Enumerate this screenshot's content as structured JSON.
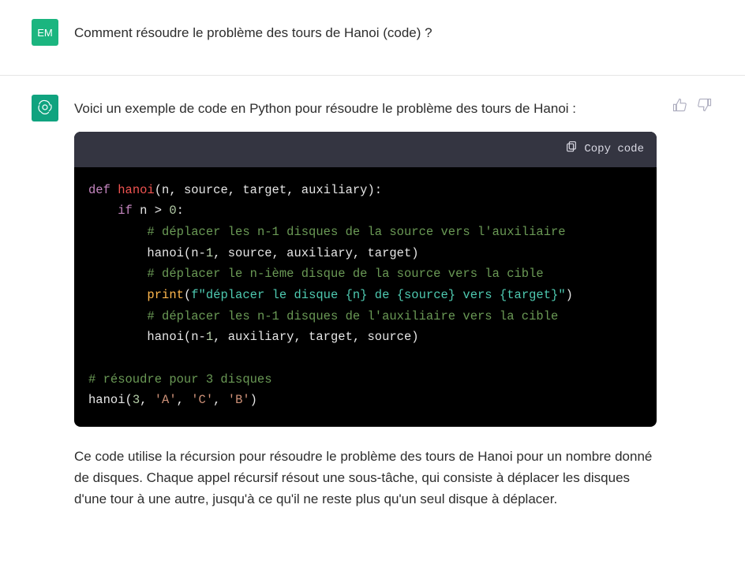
{
  "user": {
    "avatar_initials": "EM",
    "question": "Comment résoudre le problème des tours de Hanoi (code) ?"
  },
  "assistant": {
    "intro": "Voici un exemple de code en Python pour résoudre le problème des tours de Hanoi :",
    "copy_label": "Copy code",
    "explanation": "Ce code utilise la récursion pour résoudre le problème des tours de Hanoi pour un nombre donné de disques. Chaque appel récursif résout une sous-tâche, qui consiste à déplacer les disques d'une tour à une autre, jusqu'à ce qu'il ne reste plus qu'un seul disque à déplacer.",
    "code_tokens": [
      [
        [
          "kw",
          "def "
        ],
        [
          "fn",
          "hanoi"
        ],
        [
          "plain",
          "(n, source, target, auxiliary):"
        ]
      ],
      [
        [
          "plain",
          "    "
        ],
        [
          "kw",
          "if"
        ],
        [
          "plain",
          " n > "
        ],
        [
          "num",
          "0"
        ],
        [
          "plain",
          ":"
        ]
      ],
      [
        [
          "plain",
          "        "
        ],
        [
          "cmt",
          "# déplacer les n-1 disques de la source vers l'auxiliaire"
        ]
      ],
      [
        [
          "plain",
          "        hanoi(n-"
        ],
        [
          "num",
          "1"
        ],
        [
          "plain",
          ", source, auxiliary, target)"
        ]
      ],
      [
        [
          "plain",
          "        "
        ],
        [
          "cmt",
          "# déplacer le n-ième disque de la source vers la cible"
        ]
      ],
      [
        [
          "plain",
          "        "
        ],
        [
          "call",
          "print"
        ],
        [
          "plain",
          "("
        ],
        [
          "fstr",
          "f\"déplacer le disque {n} de {source} vers {target}\""
        ],
        [
          "plain",
          ")"
        ]
      ],
      [
        [
          "plain",
          "        "
        ],
        [
          "cmt",
          "# déplacer les n-1 disques de l'auxiliaire vers la cible"
        ]
      ],
      [
        [
          "plain",
          "        hanoi(n-"
        ],
        [
          "num",
          "1"
        ],
        [
          "plain",
          ", auxiliary, target, source)"
        ]
      ],
      [
        [
          "plain",
          ""
        ]
      ],
      [
        [
          "cmt",
          "# résoudre pour 3 disques"
        ]
      ],
      [
        [
          "plain",
          "hanoi("
        ],
        [
          "num",
          "3"
        ],
        [
          "plain",
          ", "
        ],
        [
          "str",
          "'A'"
        ],
        [
          "plain",
          ", "
        ],
        [
          "str",
          "'C'"
        ],
        [
          "plain",
          ", "
        ],
        [
          "str",
          "'B'"
        ],
        [
          "plain",
          ")"
        ]
      ]
    ]
  }
}
